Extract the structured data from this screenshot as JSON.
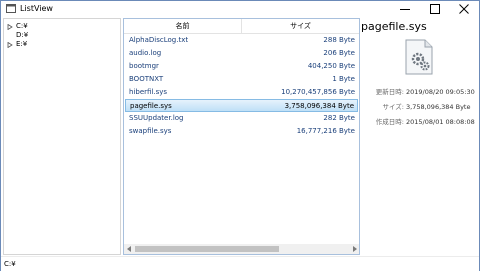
{
  "window": {
    "title": "ListView",
    "minimize_glyph": "—",
    "maximize_glyph": "☐",
    "close_glyph": "✕"
  },
  "tree": {
    "items": [
      {
        "label": "C:¥",
        "expander": "▷"
      },
      {
        "label": "D:¥",
        "expander": ""
      },
      {
        "label": "E:¥",
        "expander": "▷"
      }
    ]
  },
  "list": {
    "columns": [
      "名前",
      "サイズ"
    ],
    "rows": [
      {
        "name": "AlphaDiscLog.txt",
        "size": "288 Byte"
      },
      {
        "name": "audio.log",
        "size": "206 Byte"
      },
      {
        "name": "bootmgr",
        "size": "404,250 Byte"
      },
      {
        "name": "BOOTNXT",
        "size": "1 Byte"
      },
      {
        "name": "hiberfil.sys",
        "size": "10,270,457,856 Byte"
      },
      {
        "name": "pagefile.sys",
        "size": "3,758,096,384 Byte"
      },
      {
        "name": "SSUUpdater.log",
        "size": "282 Byte"
      },
      {
        "name": "swapfile.sys",
        "size": "16,777,216 Byte"
      }
    ],
    "selected_index": 5
  },
  "details": {
    "title": "pagefile.sys",
    "icon": "system-file-gear-icon",
    "modified_label": "更新日時:",
    "modified_value": "2019/08/20 09:05:30",
    "size_label": "サイズ:",
    "size_value": "3,758,096,384 Byte",
    "created_label": "作成日時:",
    "created_value": "2015/08/01 08:08:08"
  },
  "status": {
    "text": "C:¥"
  },
  "colors": {
    "selection_bg": "#cce8ff",
    "selection_border": "#86bbe4",
    "item_text": "#1a3f7a",
    "scroll_thumb": "#c2c2c2"
  }
}
